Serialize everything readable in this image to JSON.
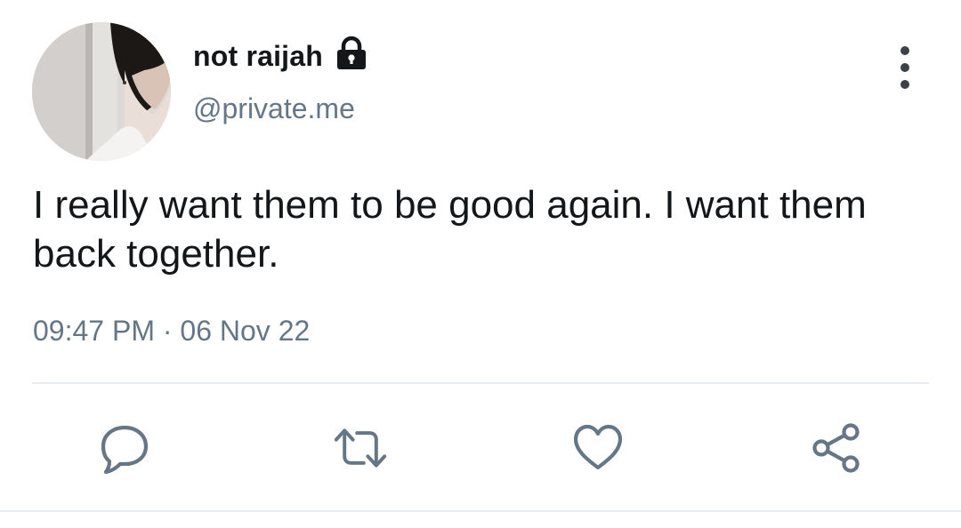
{
  "tweet": {
    "display_name": "not raijah",
    "handle": "@private.me",
    "protected_icon": "lock-icon",
    "text": "I really want them to be good again. I want them back together.",
    "time": "09:47 PM",
    "separator": "·",
    "date": "06 Nov 22"
  },
  "actions": {
    "reply_icon": "comment-icon",
    "retweet_icon": "retweet-icon",
    "like_icon": "heart-icon",
    "share_icon": "share-icon",
    "more_icon": "more-vertical-icon"
  },
  "colors": {
    "text": "#14171a",
    "secondary": "#657786",
    "action_icon": "#657786",
    "divider": "#e6ecf0"
  }
}
